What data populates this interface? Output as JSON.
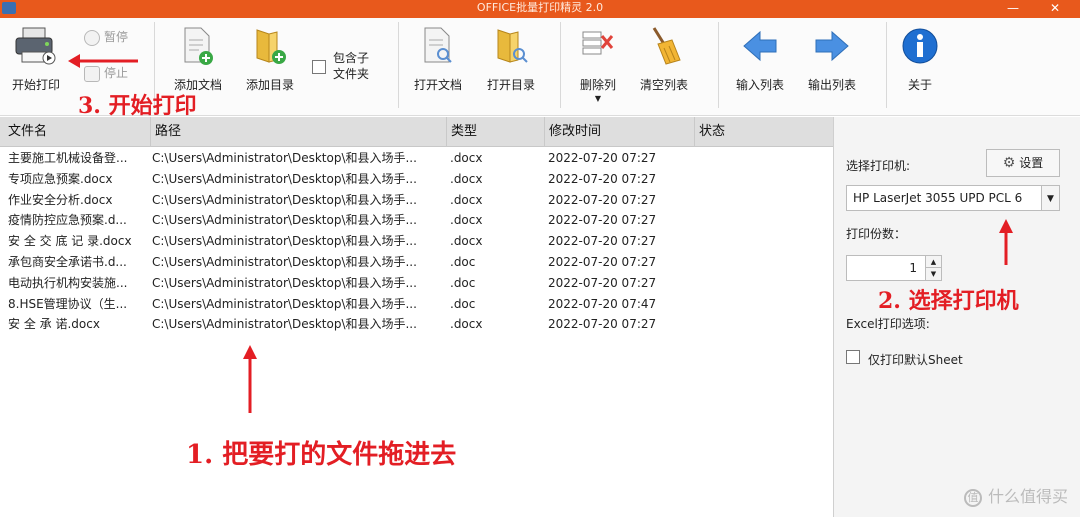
{
  "window": {
    "title": "OFFICE批量打印精灵 2.0",
    "minimize": "—",
    "close": "✕"
  },
  "toolbar": {
    "start_print": "开始打印",
    "pause": "暂停",
    "stop": "停止",
    "add_file": "添加文档",
    "add_folder": "添加目录",
    "include_sub": "包含子\n文件夹",
    "include_sub_line1": "包含子",
    "include_sub_line2": "文件夹",
    "open_doc": "打开文档",
    "open_dir": "打开目录",
    "delete_col": "删除列",
    "clear_list": "清空列表",
    "import_list": "输入列表",
    "export_list": "输出列表",
    "about": "关于"
  },
  "annotations": {
    "step3": "3. 开始打印",
    "step2": "2. 选择打印机",
    "step1": "1. 把要打的文件拖进去"
  },
  "table": {
    "headers": [
      "文件名",
      "路径",
      "类型",
      "修改时间",
      "状态"
    ],
    "rows": [
      [
        "主要施工机械设备登...",
        "C:\\Users\\Administrator\\Desktop\\和县入场手...",
        ".docx",
        "2022-07-20 07:27",
        ""
      ],
      [
        "专项应急预案.docx",
        "C:\\Users\\Administrator\\Desktop\\和县入场手...",
        ".docx",
        "2022-07-20 07:27",
        ""
      ],
      [
        "作业安全分析.docx",
        "C:\\Users\\Administrator\\Desktop\\和县入场手...",
        ".docx",
        "2022-07-20 07:27",
        ""
      ],
      [
        "疫情防控应急预案.d...",
        "C:\\Users\\Administrator\\Desktop\\和县入场手...",
        ".docx",
        "2022-07-20 07:27",
        ""
      ],
      [
        "安 全 交 底 记 录.docx",
        "C:\\Users\\Administrator\\Desktop\\和县入场手...",
        ".docx",
        "2022-07-20 07:27",
        ""
      ],
      [
        "承包商安全承诺书.d...",
        "C:\\Users\\Administrator\\Desktop\\和县入场手...",
        ".doc",
        "2022-07-20 07:27",
        ""
      ],
      [
        "电动执行机构安装施...",
        "C:\\Users\\Administrator\\Desktop\\和县入场手...",
        ".doc",
        "2022-07-20 07:27",
        ""
      ],
      [
        "8.HSE管理协议（生...",
        "C:\\Users\\Administrator\\Desktop\\和县入场手...",
        ".doc",
        "2022-07-20 07:47",
        ""
      ],
      [
        "安 全 承 诺.docx",
        "C:\\Users\\Administrator\\Desktop\\和县入场手...",
        ".docx",
        "2022-07-20 07:27",
        ""
      ]
    ]
  },
  "panel": {
    "select_printer_label": "选择打印机:",
    "settings_button": "设置",
    "printer_value": "HP LaserJet 3055 UPD PCL 6",
    "copies_label": "打印份数：",
    "copies_value": "1",
    "excel_options_label": "Excel打印选项:",
    "default_sheet_label": "仅打印默认Sheet"
  },
  "watermark": "什么值得买",
  "colors": {
    "titlebar": "#e8591c",
    "annotation": "#e31e24",
    "header_bg": "#dedede",
    "arrow_blue": "#4a90e2"
  }
}
